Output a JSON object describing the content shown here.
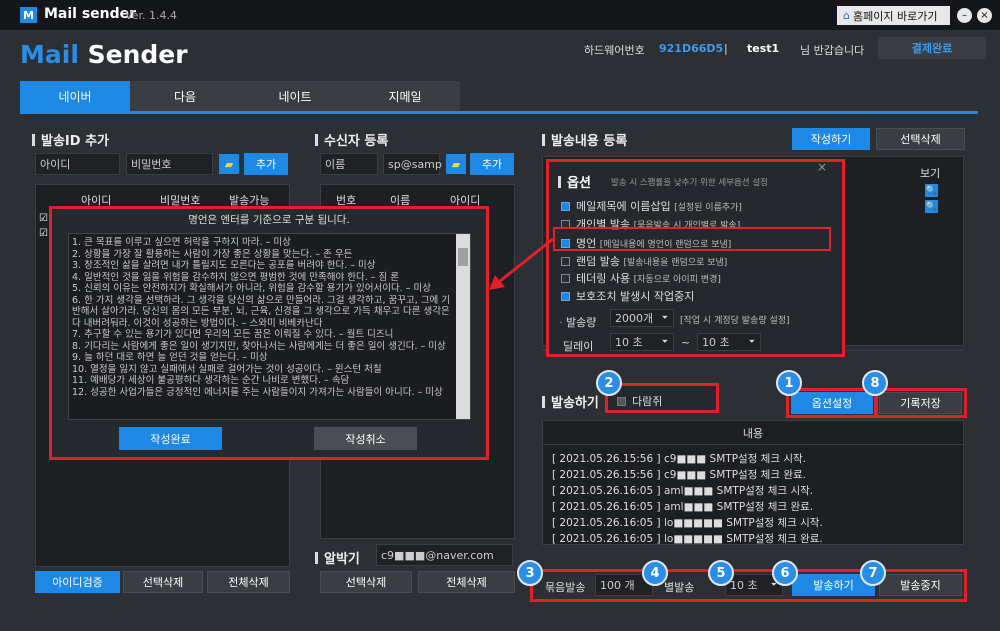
{
  "titlebar": {
    "logo": "M",
    "app_name": "Mail sender",
    "version": "Ver. 1.4.4",
    "homepage_button": "홈페이지 바로가기"
  },
  "header": {
    "brand_mail": "Mail",
    "brand_sender": "Sender",
    "hw_label": "하드웨어번호",
    "hw_value": "921D66D5",
    "separator": "|",
    "user": "test1",
    "greeting": "님 반갑습니다",
    "payment": "결제완료"
  },
  "tabs": [
    "네이버",
    "다음",
    "네이트",
    "지메일"
  ],
  "sender_id": {
    "title": "발송ID 추가",
    "id_placeholder": "아이디",
    "pw_placeholder": "비밀번호",
    "add": "추가",
    "cols": [
      "아이디",
      "비밀번호",
      "발송가능"
    ],
    "verify": "아이디검증",
    "delete_selected": "선택삭제",
    "delete_all": "전체삭제"
  },
  "recipient": {
    "title": "수신자 등록",
    "name_placeholder": "이름",
    "email_value": "sp@samp",
    "add": "추가",
    "cols": [
      "번호",
      "이름",
      "아이디"
    ],
    "delete_selected": "선택삭제",
    "delete_all": "전체삭제"
  },
  "alarm": {
    "title": "알박기",
    "email": "c9■■■@naver.com"
  },
  "content": {
    "title": "발송내용 등록",
    "write": "작성하기",
    "delete_selected": "선택삭제",
    "view_col": "보기"
  },
  "options": {
    "title": "옵션",
    "subtitle": "발송 시 스팸률을 낮추기 위한 세부옵션 설정",
    "close": "×",
    "items": [
      {
        "label": "메일제목에 이름삽입",
        "desc": "[설정된 이름추가]",
        "checked": true
      },
      {
        "label": "개인별 발송",
        "desc": "[묶음발송 시 개인별로 발송]",
        "checked": false
      },
      {
        "label": "명언",
        "desc": "[메일내용에 명언이 랜덤으로 보냄]",
        "checked": true
      },
      {
        "label": "랜덤 발송",
        "desc": "[발송내용을 랜덤으로 보냄]",
        "checked": false
      },
      {
        "label": "테더링 사용",
        "desc": "[자동으로 아이피 변경]",
        "checked": false
      },
      {
        "label": "보호조치 발생시 작업중지",
        "desc": "",
        "checked": true
      }
    ],
    "amount_label": "발송량",
    "amount_value": "2000개",
    "amount_desc": "[작업 시 계정당 발송량 설정]",
    "delay_label": "딜레이",
    "delay_from": "10 초",
    "tilde": "~",
    "delay_to": "10 초"
  },
  "send": {
    "title": "발송하기",
    "daram": "다람쥐",
    "option_setting": "옵션설정",
    "save_record": "기록저장",
    "log_header": "내용",
    "logs": [
      {
        "time": "[ 2021.05.26.15:56 ]",
        "msg": "c9■■■ SMTP설정 체크 시작."
      },
      {
        "time": "[ 2021.05.26.15:56 ]",
        "msg": "c9■■■ SMTP설정 체크 완료."
      },
      {
        "time": "[ 2021.05.26.16:05 ]",
        "msg": "aml■■■ SMTP설정 체크 시작."
      },
      {
        "time": "[ 2021.05.26.16:05 ]",
        "msg": "aml■■■ SMTP설정 체크 완료."
      },
      {
        "time": "[ 2021.05.26.16:05 ]",
        "msg": "lo■■■■■ SMTP설정 체크 시작."
      },
      {
        "time": "[ 2021.05.26.16:05 ]",
        "msg": "lo■■■■■ SMTP설정 체크 완료."
      }
    ],
    "bundle_label": "묶음발송",
    "bundle_value": "100 개",
    "separate_label": "별발송",
    "delay_value": "10 초",
    "send_button": "발송하기",
    "stop_button": "발송중지"
  },
  "quote_dialog": {
    "title": "명언은 엔터를 기준으로 구분 됩니다.",
    "text": "1. 큰 목표를 이루고 싶으면 허락을 구하지 마라. – 미상\n2. 상황을 가장 잘 활용하는 사람이 가장 좋은 상황을 맞는다. – 존 우든\n3. 창조적인 삶을 살려면 내가 틀릴지도 모른다는 공포를 버려야 한다. – 미상\n4. 일반적인 것을 잃을 위험을 감수하지 않으면 평범한 것에 만족해야 한다. – 짐 론\n5. 신뢰의 이유는 안전하지가 확실해서가 아니라, 위험을 감수할 용기가 있어서이다. – 미상\n6. 한 가지 생각을 선택하라. 그 생각을 당신의 삶으로 만들어라. 그걸 생각하고, 꿈꾸고, 그에 기반해서 살아가라. 당신의 몸의 모든 부분, 뇌, 근육, 신경을 그 생각으로 가득 채우고 다른 생각은 다 내버려둬라. 이것이 성공하는 방법이다. – 스와미 비베카난다\n7. 추구할 수 있는 용기가 있다면 우리의 모든 꿈은 이뤄질 수 있다. – 월트 디즈니\n8. 기다리는 사람에게 좋은 일이 생기지만, 찾아나서는 사람에게는 더 좋은 일이 생긴다. – 미상\n9. 늘 하던 대로 하면 늘 얻던 것을 얻는다. – 미상\n10. 열정을 잃지 않고 실패에서 실패로 걸어가는 것이 성공이다. – 윈스턴 처칠\n11. 예배당가 세상이 불공평하다 생각하는 순간 나비로 변했다. – 속담\n12. 성공한 사업가들은 긍정적인 에너지를 주는 사람들이지 가져가는 사람들이 아니다. – 미상",
    "complete": "작성완료",
    "cancel": "작성취소"
  },
  "badges": [
    "1",
    "2",
    "3",
    "4",
    "5",
    "6",
    "7",
    "8"
  ]
}
